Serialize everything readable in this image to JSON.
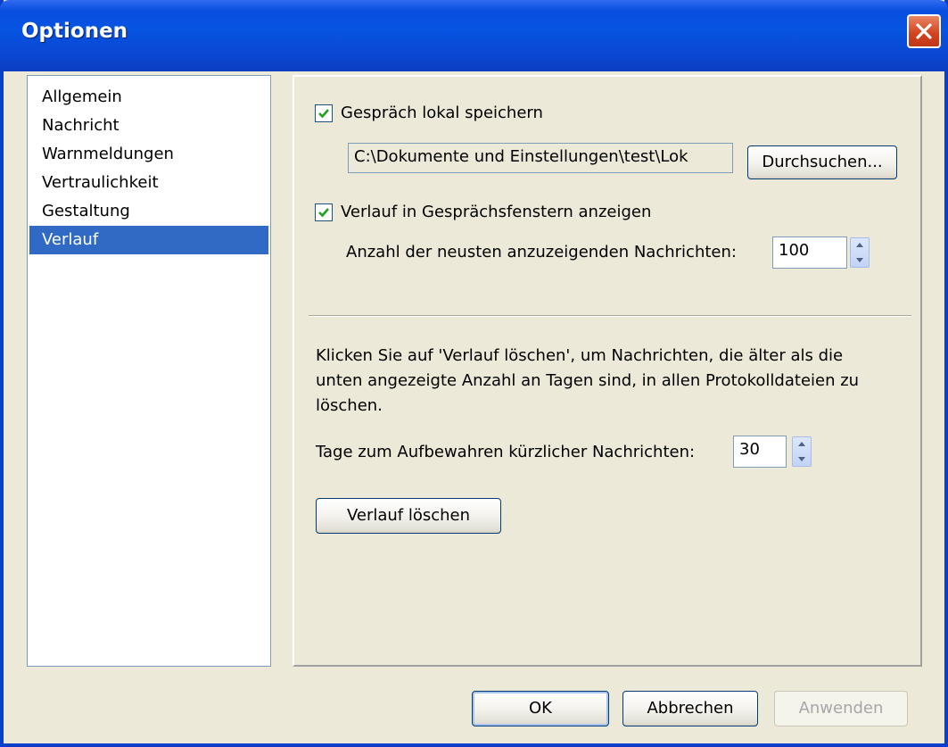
{
  "window": {
    "title": "Optionen",
    "close_icon": "close-icon"
  },
  "sidebar": {
    "items": [
      {
        "label": "Allgemein",
        "selected": false
      },
      {
        "label": "Nachricht",
        "selected": false
      },
      {
        "label": "Warnmeldungen",
        "selected": false
      },
      {
        "label": "Vertraulichkeit",
        "selected": false
      },
      {
        "label": "Gestaltung",
        "selected": false
      },
      {
        "label": "Verlauf",
        "selected": true
      }
    ]
  },
  "history": {
    "save_local": {
      "label": "Gespräch lokal speichern",
      "checked": true
    },
    "path": {
      "value": "C:\\Dokumente und Einstellungen\\test\\Lok"
    },
    "browse_button": {
      "label": "Durchsuchen..."
    },
    "show_history": {
      "label": "Verlauf in Gesprächsfenstern anzeigen",
      "checked": true
    },
    "message_count": {
      "label": "Anzahl der neusten anzuzeigenden Nachrichten:",
      "value": "100"
    },
    "info_text": {
      "line1": "Klicken Sie auf 'Verlauf löschen', um Nachrichten, die älter als die",
      "line2": "unten angezeigte Anzahl an Tagen sind, in allen Protokolldateien zu",
      "line3": "löschen."
    },
    "days_keep": {
      "label": "Tage zum Aufbewahren kürzlicher Nachrichten:",
      "value": "30"
    },
    "clear_button": {
      "label": "Verlauf löschen"
    }
  },
  "footer": {
    "ok_label": "OK",
    "cancel_label": "Abbrechen",
    "apply_label": "Anwenden"
  },
  "colors": {
    "titlebar": "#0a4ee0",
    "selection": "#316ac5",
    "checkmark": "#21a121"
  }
}
